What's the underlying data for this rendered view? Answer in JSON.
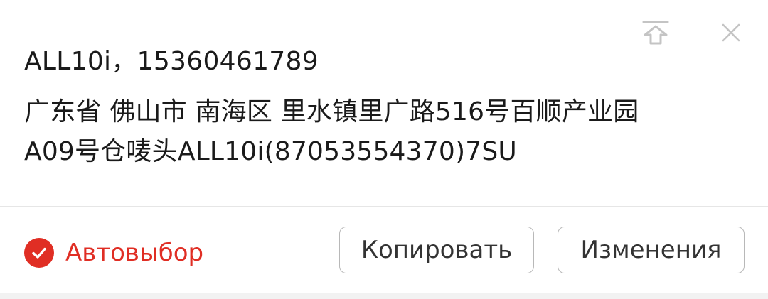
{
  "address_card": {
    "recipient_line": "ALL10i，15360461789",
    "address_line_1": "广东省 佛山市 南海区 里水镇里广路516号百顺产业园",
    "address_line_2": "A09号仓唛头ALL10i(87053554370)7SU"
  },
  "actions": {
    "auto_select_label": "Автовыбор",
    "copy_label": "Копировать",
    "edit_label": "Изменения"
  },
  "icons": {
    "pin_top": "pin-to-top-icon",
    "close": "close-icon",
    "check": "checkmark-icon"
  },
  "colors": {
    "accent": "#e02e24",
    "text": "#1a1a1a",
    "button_border": "#b8b8b8",
    "icon_gray": "#c4c4c4"
  }
}
